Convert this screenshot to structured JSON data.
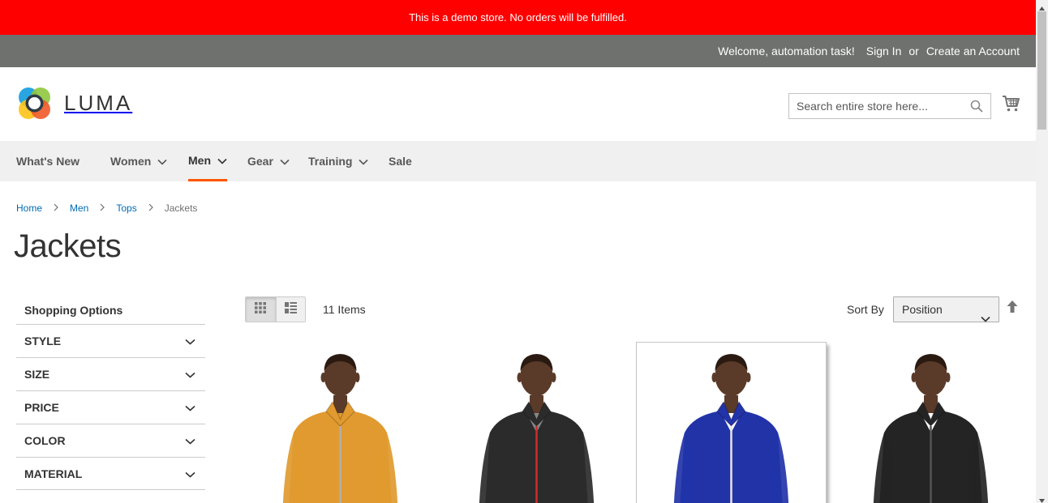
{
  "demo_notice": "This is a demo store. No orders will be fulfilled.",
  "header_links": {
    "welcome": "Welcome, automation task!",
    "sign_in": "Sign In",
    "or": "or",
    "create_account": "Create an Account"
  },
  "logo": {
    "text": "LUMA"
  },
  "search": {
    "placeholder": "Search entire store here..."
  },
  "nav": {
    "items": [
      {
        "label": "What's New",
        "has_dropdown": false,
        "active": false
      },
      {
        "label": "Women",
        "has_dropdown": true,
        "active": false
      },
      {
        "label": "Men",
        "has_dropdown": true,
        "active": true
      },
      {
        "label": "Gear",
        "has_dropdown": true,
        "active": false
      },
      {
        "label": "Training",
        "has_dropdown": true,
        "active": false
      },
      {
        "label": "Sale",
        "has_dropdown": false,
        "active": false
      }
    ]
  },
  "breadcrumbs": [
    "Home",
    "Men",
    "Tops",
    "Jackets"
  ],
  "page_title": "Jackets",
  "sidebar": {
    "title": "Shopping Options",
    "filters": [
      "STYLE",
      "SIZE",
      "PRICE",
      "COLOR",
      "MATERIAL"
    ]
  },
  "toolbar": {
    "view_modes": [
      "grid",
      "list"
    ],
    "active_mode": "grid",
    "item_count": "11 Items",
    "sort_label": "Sort By",
    "sort_value": "Position"
  },
  "products": [
    {
      "jacket_color": "#e09a2f",
      "zip_color": "#b0b0b0",
      "inner_color": "#e09a2f",
      "hovered": false
    },
    {
      "jacket_color": "#2b2b2b",
      "zip_color": "#d22a2a",
      "inner_color": "#888888",
      "hovered": false
    },
    {
      "jacket_color": "#2233a8",
      "zip_color": "#e6e6e6",
      "inner_color": "#ffffff",
      "hovered": true
    },
    {
      "jacket_color": "#242424",
      "zip_color": "#555555",
      "inner_color": "#ffffff",
      "hovered": false
    }
  ],
  "colors": {
    "demo_bar": "#ff0000",
    "panel_header": "#6e716e",
    "nav_bg": "#f0f0f0",
    "active_underline": "#ff5501",
    "link": "#006bb4"
  }
}
